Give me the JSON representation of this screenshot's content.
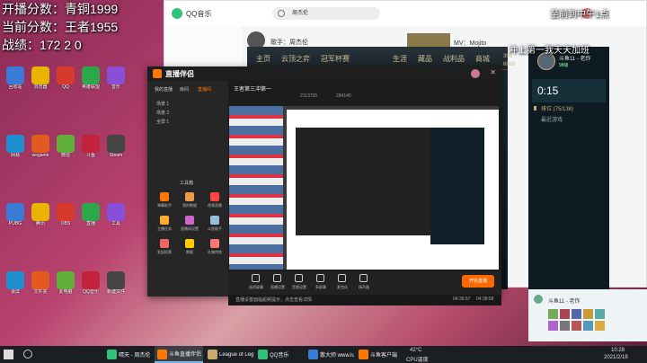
{
  "overlay": {
    "line1": "开播分数：青铜1999",
    "line2": "当前分数：王者1955",
    "line3": "战绩：172 2 0",
    "right_time": "至前到中午1点",
    "right_msg": "冲上第一我天天加班"
  },
  "desktop_icons": [
    "回收站",
    "浏览器",
    "QQ",
    "英雄联盟",
    "音乐",
    "网易",
    "wegame",
    "微信",
    "斗鱼",
    "Steam",
    "PUBG",
    "腾讯",
    "OBS",
    "直播",
    "工具",
    "录屏",
    "文件夹",
    "此电脑",
    "QQ音乐",
    "新建文件"
  ],
  "qq_music": {
    "title": "QQ音乐",
    "search": "周杰伦",
    "singer_label": "歌手：周杰伦",
    "mv_label": "MV：Mojito"
  },
  "lol": {
    "nav": [
      "主页",
      "云顶之弈",
      "冠军杯赛",
      "生涯",
      "藏品",
      "战利品",
      "商城"
    ],
    "rp": "398",
    "be": "6868"
  },
  "app": {
    "logo": "直播伴侣",
    "left_tabs": [
      "我的直播",
      "房间",
      "直播间"
    ],
    "scenes": [
      "场景 1",
      "场景 2",
      "全屏 1"
    ],
    "tools_title": "工具箱",
    "tools": [
      "弹幕助手",
      "我的数据",
      "视频直播",
      "主播任务",
      "直播间设置",
      "斗鱼助手",
      "发起投票",
      "数据",
      "礼物特效"
    ],
    "room_title": "王者第三冲第一",
    "viewers": "2113735",
    "fans": "284140",
    "bottom": [
      "画质屏幕",
      "直播设置",
      "音频设置",
      "多屏幕",
      "麦克风",
      "扬声器"
    ],
    "live_button": "开始直播",
    "notice": "直播设置面临超频提示，点击查看详情",
    "times": [
      "04:36:57",
      "04:38:58"
    ]
  },
  "side": {
    "username": "斗鱼11 - 老炸",
    "level": "98级",
    "timer": "0:15",
    "tab1": "排位 (75/138)",
    "tab2": "最近游戏"
  },
  "chat": {
    "username": "斗鱼11 - 老炸"
  },
  "taskbar": {
    "items": [
      "晴天 - 周杰伦",
      "斗鱼直播伴侣",
      "League of Lege...",
      "QQ音乐",
      "散大师 www.lud...",
      "斗鱼客户端"
    ],
    "temp": "42°C",
    "cpu": "CPU温度",
    "clock": "10:28",
    "date": "2021/2/18"
  },
  "colors": {
    "accent": "#ff6a00",
    "douyu_orange": "#ff7700",
    "lol_gold": "#c8aa6e"
  }
}
